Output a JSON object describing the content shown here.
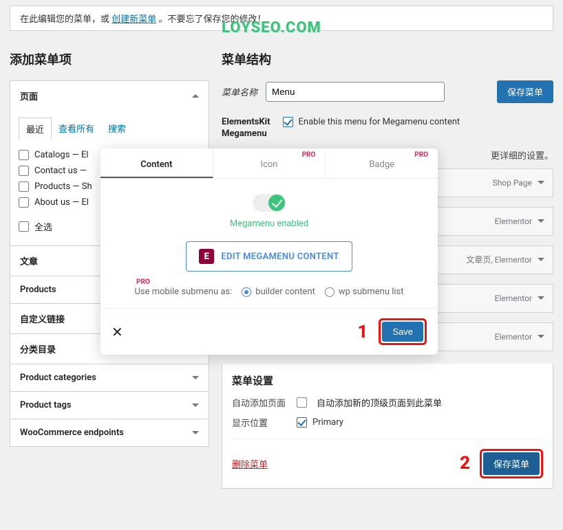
{
  "top_notice": {
    "prefix": "在此编辑您的菜单，或",
    "link": "创建新菜单",
    "suffix": "。不要忘了保存您的修改！"
  },
  "watermark": "LOYSEO.COM",
  "left": {
    "title": "添加菜单项",
    "sections": {
      "page": {
        "label": "页面",
        "tabs": {
          "recent": "最近",
          "all": "查看所有",
          "search": "搜索"
        },
        "items": [
          "Catalogs — El",
          "Contact us —",
          "Products — Sh",
          "About us — El"
        ],
        "select_all": "全选"
      },
      "post": "文章",
      "products": "Products",
      "custom": "自定义链接",
      "cat": "分类目录",
      "pcat": "Product categories",
      "ptag": "Product tags",
      "woo": "WooCommerce endpoints"
    }
  },
  "right": {
    "title": "菜单结构",
    "menu_name_label": "菜单名称",
    "menu_name_value": "Menu",
    "save_btn": "保存菜单",
    "ekit": {
      "label1": "ElementsKit",
      "label2": "Megamenu",
      "check_label": "Enable this menu for Megamenu content"
    },
    "hint": "更详细的设置。",
    "items": [
      {
        "type": "Shop Page"
      },
      {
        "type": "Elementor"
      },
      {
        "type": "文章页, Elementor"
      },
      {
        "type": "Elementor"
      },
      {
        "type": "Elementor"
      }
    ],
    "settings": {
      "heading": "菜单设置",
      "auto_label": "自动添加页面",
      "auto_text": "自动添加新的顶级页面到此菜单",
      "loc_label": "显示位置",
      "loc_text": "Primary"
    },
    "bottom": {
      "delete": "删除菜单",
      "num": "2",
      "save": "保存菜单"
    }
  },
  "modal": {
    "tabs": {
      "content": "Content",
      "icon": "Icon",
      "badge": "Badge",
      "pro": "PRO"
    },
    "toggle_label": "Megamenu enabled",
    "edit_btn": "EDIT MEGAMENU CONTENT",
    "mobile": {
      "pro": "PRO",
      "label": "Use mobile submenu as:",
      "opt1": "builder content",
      "opt2": "wp submenu list"
    },
    "footer": {
      "num": "1",
      "save": "Save",
      "close": "✕"
    }
  }
}
